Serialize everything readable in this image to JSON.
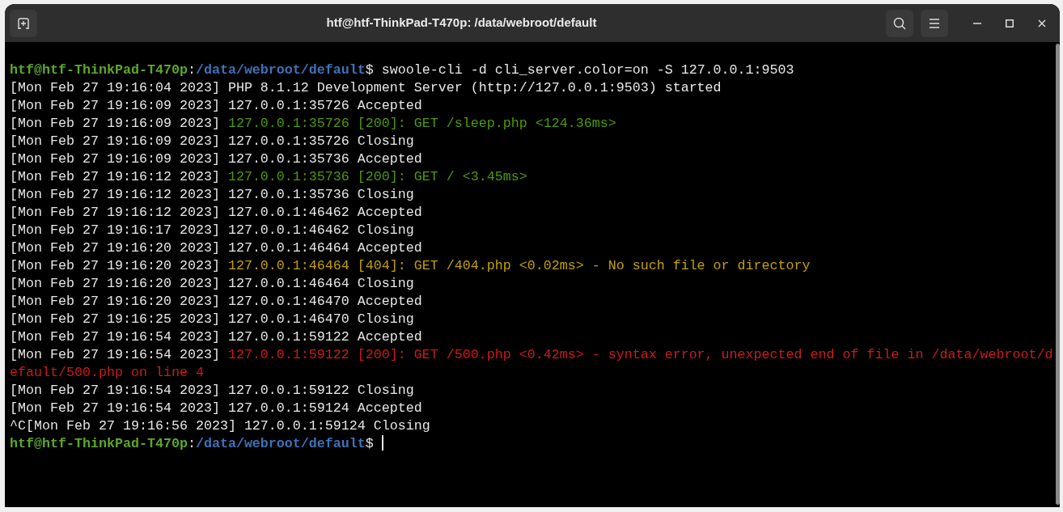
{
  "window": {
    "title": "htf@htf-ThinkPad-T470p: /data/webroot/default"
  },
  "terminal": {
    "lines": [
      {
        "kind": "prompt",
        "user_host": "htf@htf-ThinkPad-T470p",
        "separator": ":",
        "path": "/data/webroot/default",
        "prompt_char": "$",
        "command": "swoole-cli -d cli_server.color=on -S 127.0.0.1:9503"
      },
      {
        "kind": "info",
        "timestamp": "[Mon Feb 27 19:16:04 2023]",
        "message": "PHP 8.1.12 Development Server (http://127.0.0.1:9503) started"
      },
      {
        "kind": "info",
        "timestamp": "[Mon Feb 27 19:16:09 2023]",
        "message": "127.0.0.1:35726 Accepted"
      },
      {
        "kind": "success",
        "timestamp": "[Mon Feb 27 19:16:09 2023]",
        "message": "127.0.0.1:35726 [200]: GET /sleep.php <124.36ms>"
      },
      {
        "kind": "info",
        "timestamp": "[Mon Feb 27 19:16:09 2023]",
        "message": "127.0.0.1:35726 Closing"
      },
      {
        "kind": "info",
        "timestamp": "[Mon Feb 27 19:16:09 2023]",
        "message": "127.0.0.1:35736 Accepted"
      },
      {
        "kind": "success",
        "timestamp": "[Mon Feb 27 19:16:12 2023]",
        "message": "127.0.0.1:35736 [200]: GET / <3.45ms>"
      },
      {
        "kind": "info",
        "timestamp": "[Mon Feb 27 19:16:12 2023]",
        "message": "127.0.0.1:35736 Closing"
      },
      {
        "kind": "info",
        "timestamp": "[Mon Feb 27 19:16:12 2023]",
        "message": "127.0.0.1:46462 Accepted"
      },
      {
        "kind": "info",
        "timestamp": "[Mon Feb 27 19:16:17 2023]",
        "message": "127.0.0.1:46462 Closing"
      },
      {
        "kind": "info",
        "timestamp": "[Mon Feb 27 19:16:20 2023]",
        "message": "127.0.0.1:46464 Accepted"
      },
      {
        "kind": "warning",
        "timestamp": "[Mon Feb 27 19:16:20 2023]",
        "message": "127.0.0.1:46464 [404]: GET /404.php <0.02ms> - No such file or directory"
      },
      {
        "kind": "info",
        "timestamp": "[Mon Feb 27 19:16:20 2023]",
        "message": "127.0.0.1:46464 Closing"
      },
      {
        "kind": "info",
        "timestamp": "[Mon Feb 27 19:16:20 2023]",
        "message": "127.0.0.1:46470 Accepted"
      },
      {
        "kind": "info",
        "timestamp": "[Mon Feb 27 19:16:25 2023]",
        "message": "127.0.0.1:46470 Closing"
      },
      {
        "kind": "info",
        "timestamp": "[Mon Feb 27 19:16:54 2023]",
        "message": "127.0.0.1:59122 Accepted"
      },
      {
        "kind": "error",
        "timestamp": "[Mon Feb 27 19:16:54 2023]",
        "message": "127.0.0.1:59122 [200]: GET /500.php <0.42ms> - syntax error, unexpected end of file in /data/webroot/default/500.php on line 4"
      },
      {
        "kind": "info",
        "timestamp": "[Mon Feb 27 19:16:54 2023]",
        "message": "127.0.0.1:59122 Closing"
      },
      {
        "kind": "info",
        "timestamp": "[Mon Feb 27 19:16:54 2023]",
        "message": "127.0.0.1:59124 Accepted"
      },
      {
        "kind": "info",
        "timestamp": "^C[Mon Feb 27 19:16:56 2023]",
        "message": "127.0.0.1:59124 Closing"
      },
      {
        "kind": "prompt",
        "user_host": "htf@htf-ThinkPad-T470p",
        "separator": ":",
        "path": "/data/webroot/default",
        "prompt_char": "$",
        "cursor": true
      }
    ]
  }
}
